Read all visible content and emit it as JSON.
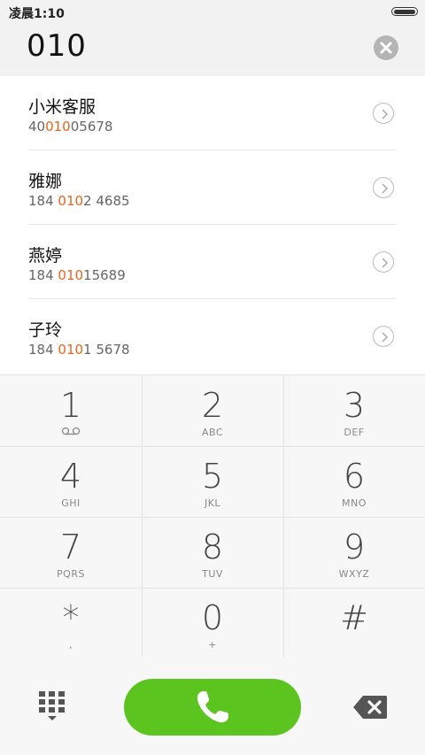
{
  "status": {
    "time": "凌晨1:10"
  },
  "dial": {
    "number": "010"
  },
  "results": [
    {
      "name": "小米客服",
      "number_pre": "40",
      "number_hl": "010",
      "number_post": "05678"
    },
    {
      "name": "雅娜",
      "number_pre": "184 ",
      "number_hl": "010",
      "number_post": "2 4685"
    },
    {
      "name": "燕婷",
      "number_pre": "184 ",
      "number_hl": "010",
      "number_post": "15689"
    },
    {
      "name": "子玲",
      "number_pre": "184 ",
      "number_hl": "010",
      "number_post": "1 5678"
    }
  ],
  "keypad": [
    {
      "digit": "1",
      "letters": ""
    },
    {
      "digit": "2",
      "letters": "ABC"
    },
    {
      "digit": "3",
      "letters": "DEF"
    },
    {
      "digit": "4",
      "letters": "GHI"
    },
    {
      "digit": "5",
      "letters": "JKL"
    },
    {
      "digit": "6",
      "letters": "MNO"
    },
    {
      "digit": "7",
      "letters": "PQRS"
    },
    {
      "digit": "8",
      "letters": "TUV"
    },
    {
      "digit": "9",
      "letters": "WXYZ"
    },
    {
      "digit": "*",
      "letters": ","
    },
    {
      "digit": "0",
      "letters": "+"
    },
    {
      "digit": "#",
      "letters": ""
    }
  ],
  "colors": {
    "call": "#5cc41f",
    "highlight": "#e8651b"
  },
  "icons": [
    "voicemail-icon",
    "clear-icon",
    "chevron-right-icon",
    "dialpad-grid-icon",
    "phone-icon",
    "backspace-icon"
  ]
}
